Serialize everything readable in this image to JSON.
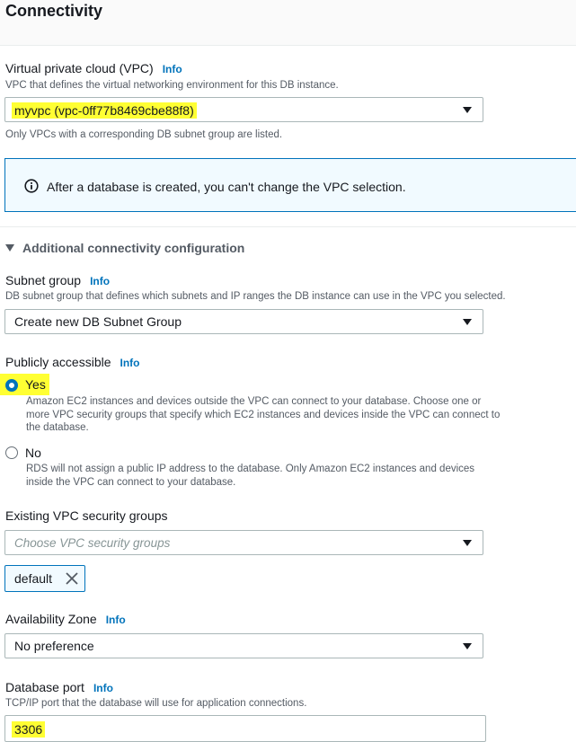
{
  "section": {
    "title": "Connectivity"
  },
  "vpc": {
    "label": "Virtual private cloud (VPC)",
    "info": "Info",
    "description": "VPC that defines the virtual networking environment for this DB instance.",
    "selected": "myvpc (vpc-0ff77b8469cbe88f8)",
    "hint": "Only VPCs with a corresponding DB subnet group are listed."
  },
  "alert": {
    "text": "After a database is created, you can't change the VPC selection."
  },
  "additional": {
    "label": "Additional connectivity configuration",
    "expanded": true
  },
  "subnet": {
    "label": "Subnet group",
    "info": "Info",
    "description": "DB subnet group that defines which subnets and IP ranges the DB instance can use in the VPC you selected.",
    "selected": "Create new DB Subnet Group"
  },
  "public": {
    "label": "Publicly accessible",
    "info": "Info",
    "options": [
      {
        "label": "Yes",
        "description": "Amazon EC2 instances and devices outside the VPC can connect to your database. Choose one or more VPC security groups that specify which EC2 instances and devices inside the VPC can connect to the database.",
        "selected": true
      },
      {
        "label": "No",
        "description": "RDS will not assign a public IP address to the database. Only Amazon EC2 instances and devices inside the VPC can connect to your database.",
        "selected": false
      }
    ]
  },
  "security_groups": {
    "label": "Existing VPC security groups",
    "placeholder": "Choose VPC security groups",
    "tokens": [
      "default"
    ]
  },
  "az": {
    "label": "Availability Zone",
    "info": "Info",
    "selected": "No preference"
  },
  "port": {
    "label": "Database port",
    "info": "Info",
    "description": "TCP/IP port that the database will use for application connections.",
    "value": "3306"
  },
  "colors": {
    "highlight": "#ffff33",
    "link": "#0073bb",
    "alert_bg": "#f1faff",
    "muted": "#545b64"
  },
  "icons": [
    "info-circle-icon",
    "caret-down-icon",
    "expand-triangle-icon",
    "close-icon"
  ]
}
